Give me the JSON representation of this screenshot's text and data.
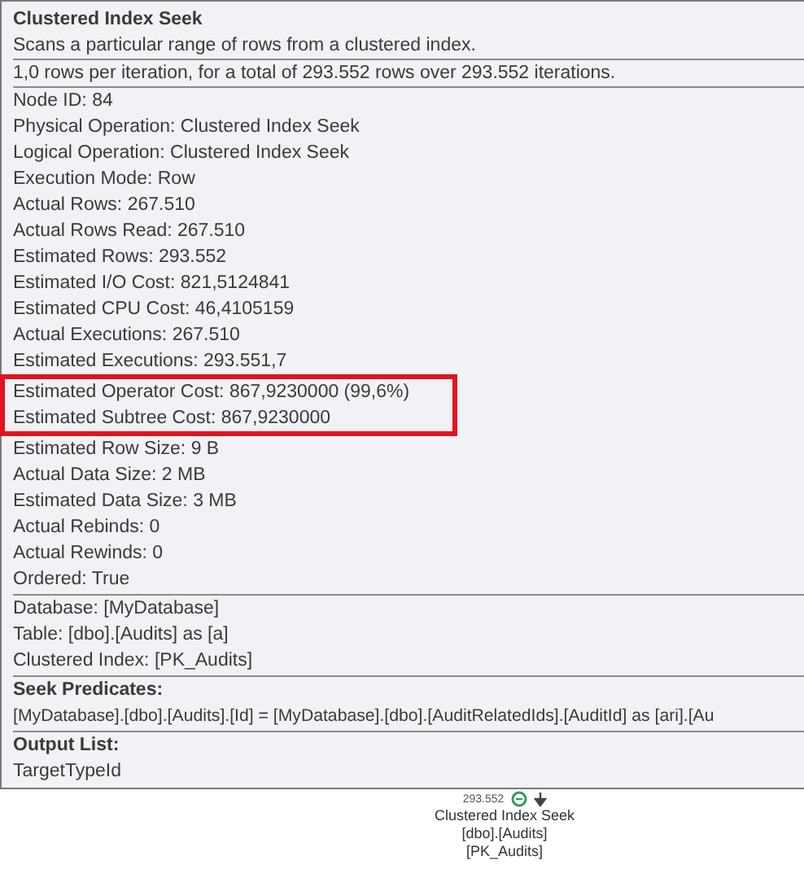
{
  "tooltip": {
    "title": "Clustered Index Seek",
    "description": "Scans a particular range of rows from a clustered index.",
    "iterations": "1,0 rows per iteration, for a total of 293.552 rows over 293.552 iterations.",
    "properties": [
      {
        "label": "Node ID:",
        "value": "84",
        "highlighted": false
      },
      {
        "label": "Physical Operation:",
        "value": "Clustered Index Seek",
        "highlighted": false
      },
      {
        "label": "Logical Operation:",
        "value": "Clustered Index Seek",
        "highlighted": false
      },
      {
        "label": "Execution Mode:",
        "value": "Row",
        "highlighted": false
      },
      {
        "label": "Actual Rows:",
        "value": "267.510",
        "highlighted": false
      },
      {
        "label": "Actual Rows Read:",
        "value": "267.510",
        "highlighted": false
      },
      {
        "label": "Estimated Rows:",
        "value": "293.552",
        "highlighted": false
      },
      {
        "label": "Estimated I/O Cost:",
        "value": "821,5124841",
        "highlighted": false
      },
      {
        "label": "Estimated CPU Cost:",
        "value": "46,4105159",
        "highlighted": false
      },
      {
        "label": "Actual Executions:",
        "value": "267.510",
        "highlighted": false
      },
      {
        "label": "Estimated Executions:",
        "value": "293.551,7",
        "highlighted": false
      },
      {
        "label": "Estimated Operator Cost:",
        "value": "867,9230000 (99,6%)",
        "highlighted": true
      },
      {
        "label": "Estimated Subtree Cost:",
        "value": "867,9230000",
        "highlighted": true
      },
      {
        "label": "Estimated Row Size:",
        "value": "9 B",
        "highlighted": false
      },
      {
        "label": "Actual Data Size:",
        "value": "2 MB",
        "highlighted": false
      },
      {
        "label": "Estimated Data Size:",
        "value": "3 MB",
        "highlighted": false
      },
      {
        "label": "Actual Rebinds:",
        "value": "0",
        "highlighted": false
      },
      {
        "label": "Actual Rewinds:",
        "value": "0",
        "highlighted": false
      },
      {
        "label": "Ordered:",
        "value": "True",
        "highlighted": false
      }
    ],
    "objects": [
      {
        "label": "Database:",
        "value": "[MyDatabase]"
      },
      {
        "label": "Table:",
        "value": "[dbo].[Audits] as [a]"
      },
      {
        "label": "Clustered Index:",
        "value": "[PK_Audits]"
      }
    ],
    "seek_predicates": {
      "heading": "Seek Predicates:",
      "text": "[MyDatabase].[dbo].[Audits].[Id] = [MyDatabase].[dbo].[AuditRelatedIds].[AuditId] as [ari].[Au"
    },
    "output_list": {
      "heading": "Output List:",
      "text": "TargetTypeId"
    }
  },
  "plan_node": {
    "row_count": "293.552",
    "labels": [
      "Clustered Index Seek",
      "[dbo].[Audits]",
      "[PK_Audits]"
    ]
  }
}
